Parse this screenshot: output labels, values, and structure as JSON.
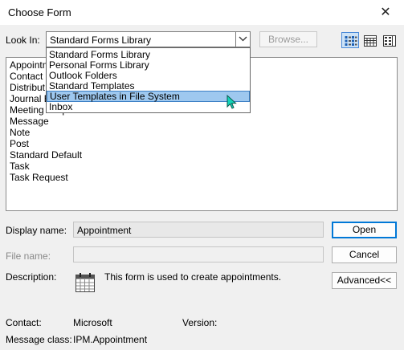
{
  "window": {
    "title": "Choose Form",
    "close_glyph": "✕"
  },
  "look_in": {
    "label": "Look In:",
    "selected": "Standard Forms Library",
    "options": [
      "Standard Forms Library",
      "Personal Forms Library",
      "Outlook Folders",
      "Standard Templates",
      "User Templates in File System",
      "Inbox"
    ],
    "highlighted_index": 4
  },
  "browse_label": "Browse...",
  "view_buttons": [
    "large-icons-icon",
    "small-icons-icon",
    "details-icon"
  ],
  "forms_list": {
    "items_visible": [
      "Appointm",
      "Contact",
      "Distribut",
      "Journal E",
      "Meeting Request",
      "Message",
      "Note",
      "Post",
      "Standard Default",
      "Task",
      "Task Request"
    ],
    "meeting_tail": "Request"
  },
  "display_name": {
    "label": "Display name:",
    "value": "Appointment"
  },
  "file_name": {
    "label": "File name:",
    "value": ""
  },
  "description": {
    "label": "Description:",
    "text": "This form is used to create appointments.",
    "icon": "calendar-icon"
  },
  "buttons": {
    "open": "Open",
    "cancel": "Cancel",
    "advanced": "Advanced<<"
  },
  "contact": {
    "label": "Contact:",
    "value": "Microsoft"
  },
  "version": {
    "label": "Version:",
    "value": ""
  },
  "message_class": {
    "label": "Message class:",
    "value": "IPM.Appointment"
  },
  "colors": {
    "selection": "#9ec8ef",
    "accent": "#0078d7"
  }
}
